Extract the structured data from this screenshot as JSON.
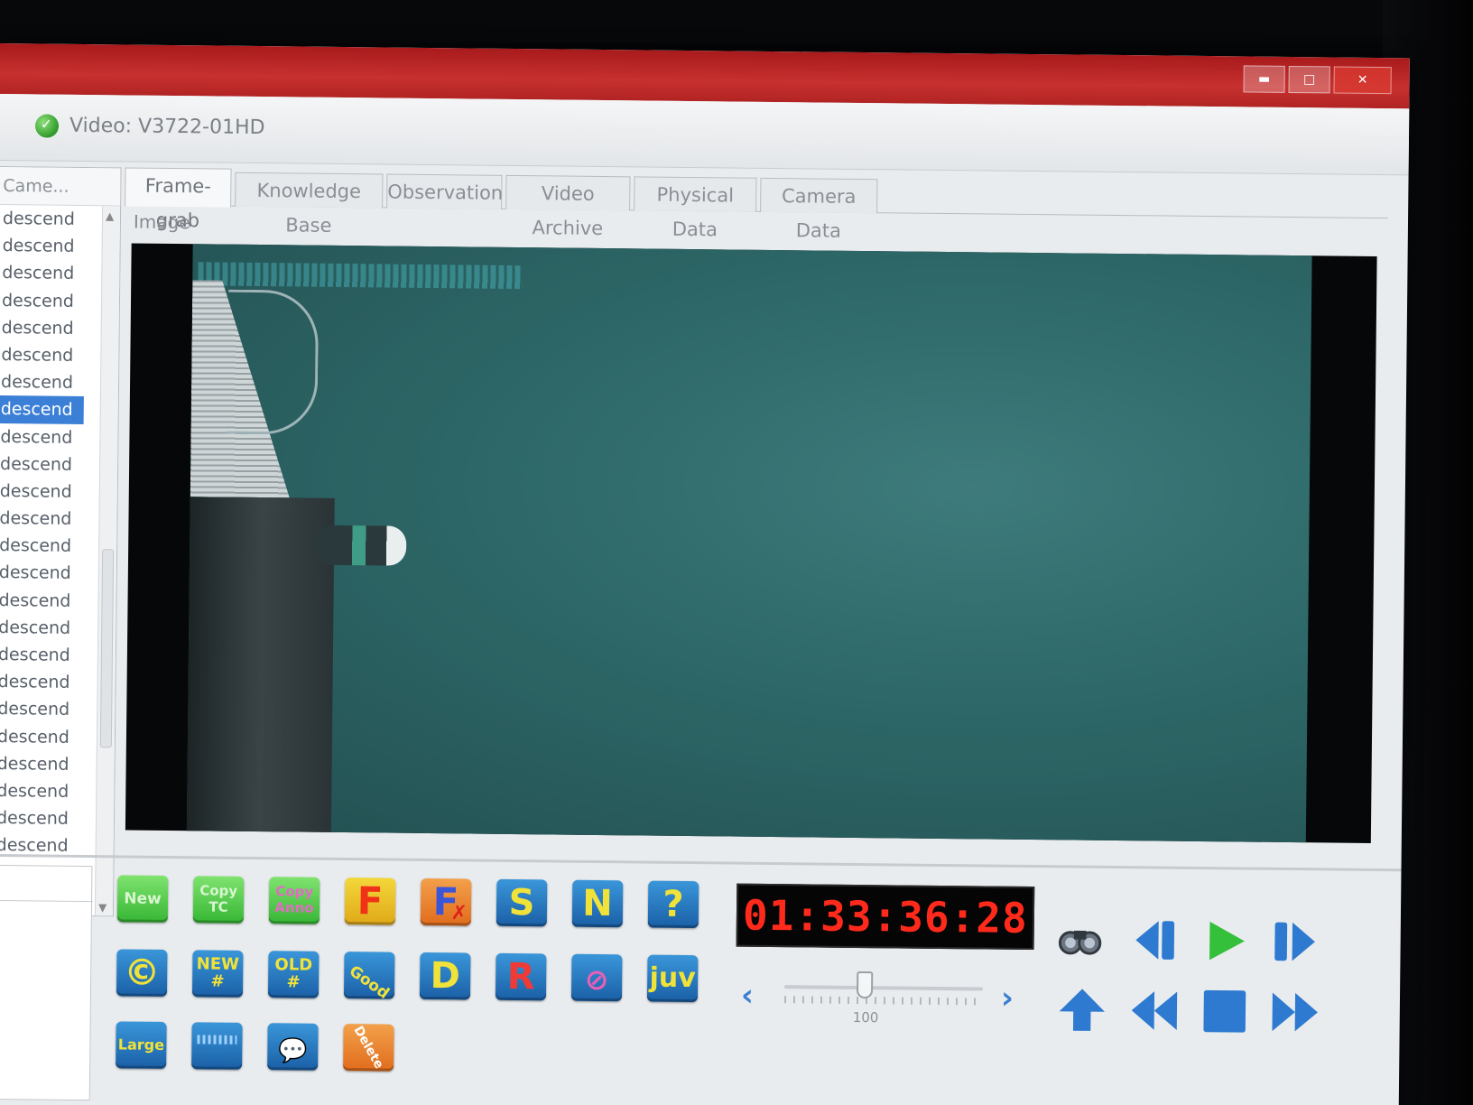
{
  "window": {
    "video_title": "Video: V3722-01HD",
    "controls": {
      "minimize": "▬",
      "maximize": "□",
      "close": "✕"
    }
  },
  "list": {
    "header": "Came...",
    "items": [
      "descend",
      "descend",
      "descend",
      "descend",
      "descend",
      "descend",
      "descend",
      "descend",
      "descend",
      "descend",
      "descend",
      "descend",
      "descend",
      "descend",
      "descend",
      "descend",
      "descend",
      "descend",
      "descend",
      "descend",
      "descend",
      "descend",
      "descend",
      "descend"
    ],
    "selected_index": 7
  },
  "tabs": [
    "Frame-grab",
    "Knowledge Base",
    "Observation",
    "Video Archive",
    "Physical Data",
    "Camera Data"
  ],
  "active_tab": 0,
  "image_label": "Image",
  "buttons": {
    "new": "New",
    "copy_tc": [
      "Copy",
      "TC"
    ],
    "copy_anno": [
      "Copy",
      "Anno"
    ],
    "f": "F",
    "f_del": "F",
    "s": "S",
    "n": "N",
    "help": "?",
    "c": "©",
    "new_num": [
      "NEW",
      "#"
    ],
    "old_num": [
      "OLD",
      "#"
    ],
    "good": "Good",
    "d": "D",
    "r": "R",
    "juv": "juv",
    "large": "Large",
    "delete": "Delete"
  },
  "timecode": "01:33:36:28",
  "speed": {
    "value": 100,
    "max": 400,
    "label": "100"
  },
  "icons": {
    "status": "check-circle-icon",
    "binoculars": "binoculars-icon",
    "step_back": "step-back-icon",
    "play": "play-icon",
    "step_forward": "step-forward-icon",
    "up": "up-arrow-icon",
    "rewind": "rewind-icon",
    "stop": "stop-icon",
    "fast_forward": "fast-forward-icon"
  },
  "colors": {
    "titlebar": "#c7312f",
    "timecode": "#ff2a1c",
    "nav_blue": "#2d7ad0",
    "play_green": "#34c03a"
  }
}
